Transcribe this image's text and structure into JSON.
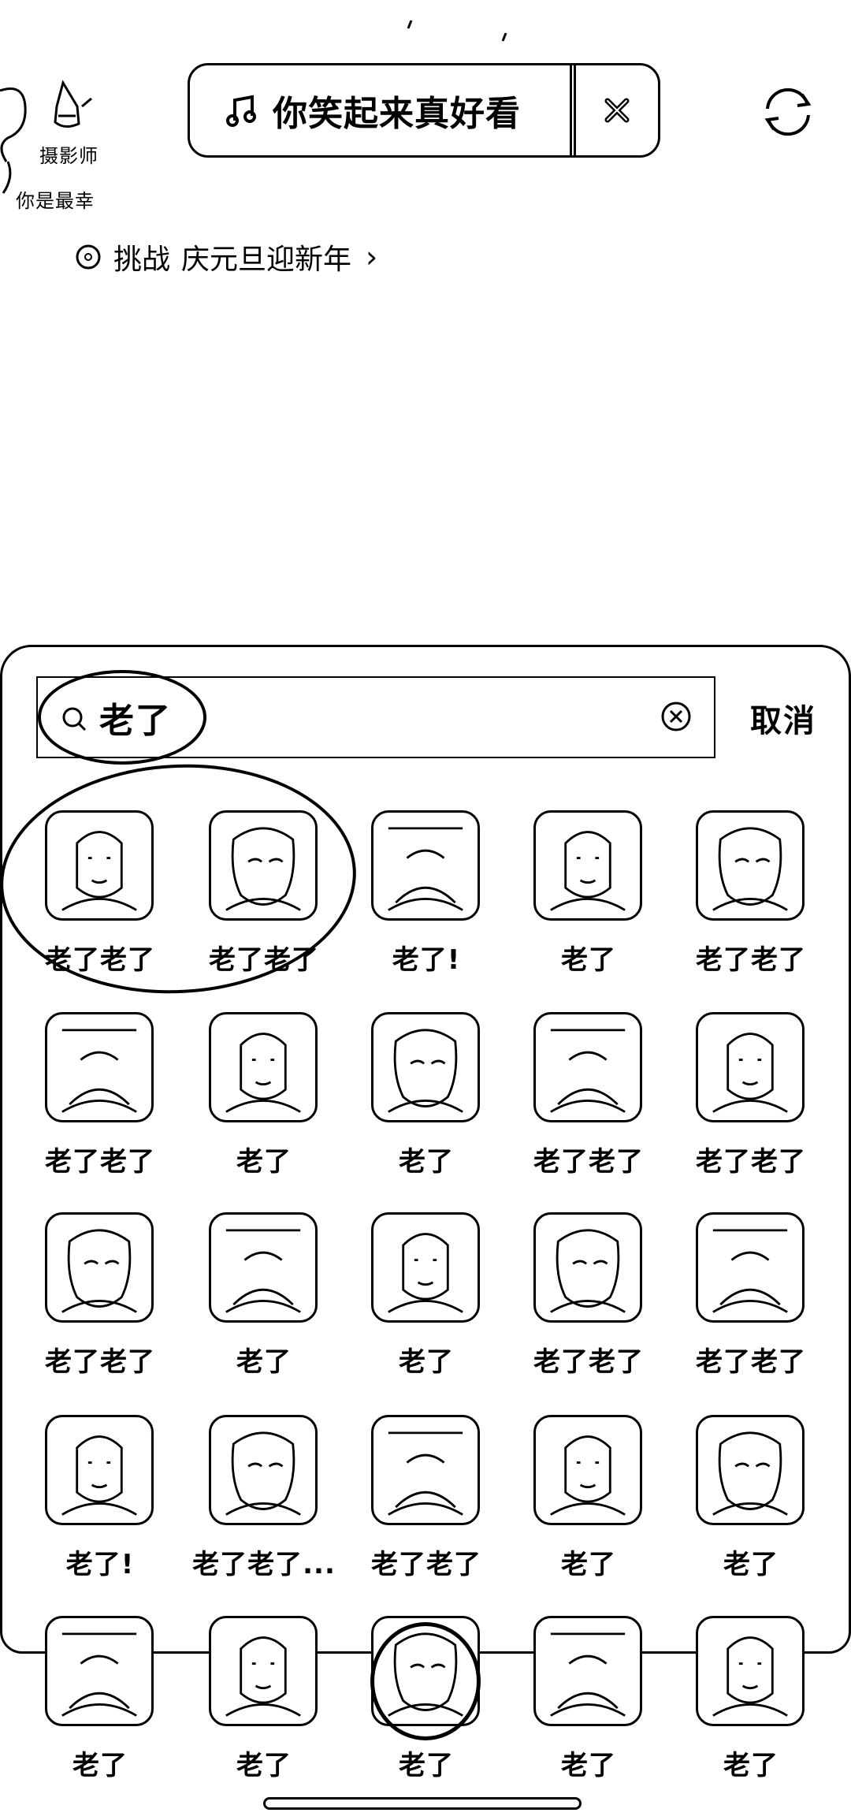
{
  "creator": {
    "name": "摄影师",
    "subtitle": "你是最幸"
  },
  "music": {
    "icon": "music-note-icon",
    "title": "你笑起来真好看",
    "close_icon": "close-icon"
  },
  "refresh_icon": "refresh-icon",
  "challenge": {
    "icon": "challenge-icon",
    "label": "挑战",
    "name": "庆元旦迎新年",
    "chevron": "›"
  },
  "search": {
    "query": "老了",
    "cancel_label": "取消"
  },
  "results": [
    {
      "caption": "老了老了"
    },
    {
      "caption": "老了老了"
    },
    {
      "caption": "老了!"
    },
    {
      "caption": "老了"
    },
    {
      "caption": "老了老了"
    },
    {
      "caption": "老了老了"
    },
    {
      "caption": "老了"
    },
    {
      "caption": "老了"
    },
    {
      "caption": "老了老了"
    },
    {
      "caption": "老了老了"
    },
    {
      "caption": "老了老了"
    },
    {
      "caption": "老了"
    },
    {
      "caption": "老了"
    },
    {
      "caption": "老了老了"
    },
    {
      "caption": "老了老了"
    },
    {
      "caption": "老了!"
    },
    {
      "caption": "老了老了..."
    },
    {
      "caption": "老了老了"
    },
    {
      "caption": "老了"
    },
    {
      "caption": "老了"
    },
    {
      "caption": "老了"
    },
    {
      "caption": "老了"
    },
    {
      "caption": "老了"
    },
    {
      "caption": "老了"
    },
    {
      "caption": "老了"
    }
  ]
}
